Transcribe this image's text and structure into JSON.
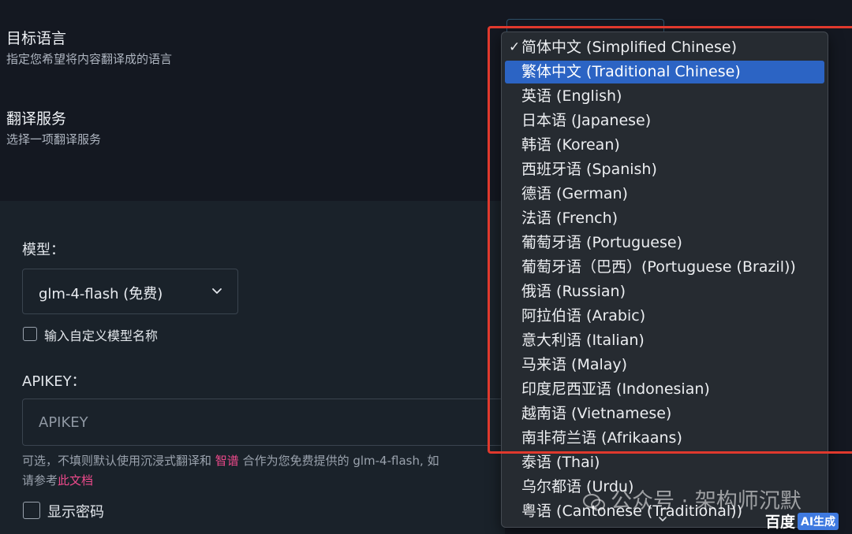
{
  "settings": {
    "target_language": {
      "title": "目标语言",
      "desc": "指定您希望将内容翻译成的语言"
    },
    "translation_service": {
      "title": "翻译服务",
      "desc": "选择一项翻译服务"
    }
  },
  "panel": {
    "model_label": "模型：",
    "model_value": "glm-4-flash (免费)",
    "custom_model_label": "输入自定义模型名称",
    "apikey_label": "APIKEY：",
    "apikey_placeholder": "APIKEY",
    "hint_part1": "可选，不填则默认使用沉浸式翻译和 ",
    "hint_link1": "智谱",
    "hint_part2": " 合作为您免费提供的 glm-4-flash, 如",
    "hint_line2_part1": "请参考",
    "hint_line2_link": "此文档",
    "show_password_label": "显示密码"
  },
  "dropdown": {
    "checkmark": "✓",
    "options": [
      "简体中文 (Simplified Chinese)",
      "繁体中文 (Traditional Chinese)",
      "英语 (English)",
      "日本语 (Japanese)",
      "韩语 (Korean)",
      "西班牙语 (Spanish)",
      "德语 (German)",
      "法语 (French)",
      "葡萄牙语 (Portuguese)",
      "葡萄牙语（巴西）(Portuguese (Brazil))",
      "俄语 (Russian)",
      "阿拉伯语 (Arabic)",
      "意大利语 (Italian)",
      "马来语 (Malay)",
      "印度尼西亚语 (Indonesian)",
      "越南语 (Vietnamese)",
      "南非荷兰语 (Afrikaans)",
      "泰语 (Thai)",
      "乌尔都语 (Urdu)",
      "粤语 (Cantonese (Traditional))"
    ],
    "checked_index": 0,
    "highlighted_index": 1
  },
  "watermark": {
    "text": "公众号 · 架构师沉默",
    "icon": "wechat-icon"
  },
  "brand": {
    "name": "百度",
    "badge": "AI生成"
  },
  "colors": {
    "accent": "#2c64c4",
    "highlight_frame": "#e0392d",
    "link": "#ee4a8c"
  }
}
